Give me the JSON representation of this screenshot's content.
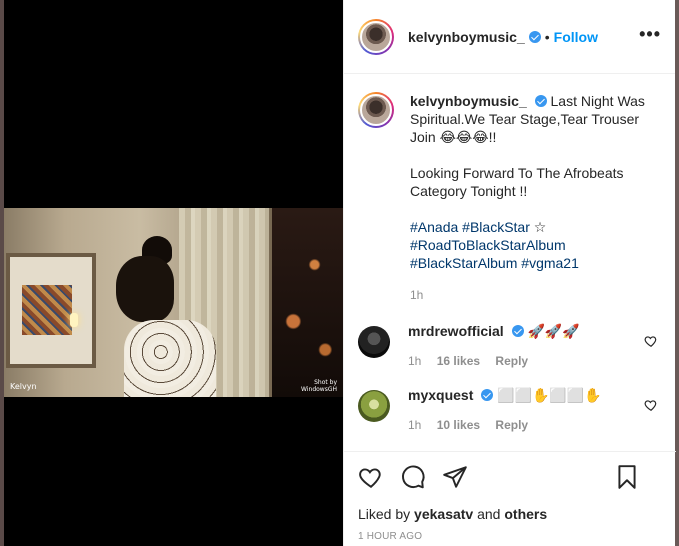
{
  "post": {
    "username": "kelvynboymusic_",
    "dot": "•",
    "follow_label": "Follow",
    "more_label": "•••"
  },
  "media": {
    "watermark_left": "Kelvyn",
    "watermark_right_1": "Shot by",
    "watermark_right_2": "WindowsGH"
  },
  "caption": {
    "username": "kelvynboymusic_",
    "line1": "Last Night Was Spiritual.We Tear Stage,Tear Trouser Join 😂😂😂!!",
    "line2": "Looking Forward To The Afrobeats Category Tonight !!",
    "tags_line1_a": "#Anada",
    "tags_line1_b": "#BlackStar",
    "tags_line1_star": "☆",
    "tags_line2": "#RoadToBlackStarAlbum",
    "tags_line3_a": "#BlackStarAlbum",
    "tags_line3_b": "#vgma21",
    "time": "1h"
  },
  "comments": [
    {
      "username": "mrdrewofficial",
      "text": "🚀🚀🚀",
      "time": "1h",
      "likes": "16 likes",
      "reply": "Reply"
    },
    {
      "username": "myxquest",
      "text": "⬜⬜✋⬜⬜✋",
      "time": "1h",
      "likes": "10 likes",
      "reply": "Reply"
    }
  ],
  "footer": {
    "liked_prefix": "Liked by",
    "liked_user": "yekasatv",
    "liked_and": "and",
    "liked_others": "others",
    "ago": "1 HOUR AGO"
  },
  "colors": {
    "accent": "#0095f6",
    "verified": "#3897f0",
    "hashtag": "#00376b"
  }
}
